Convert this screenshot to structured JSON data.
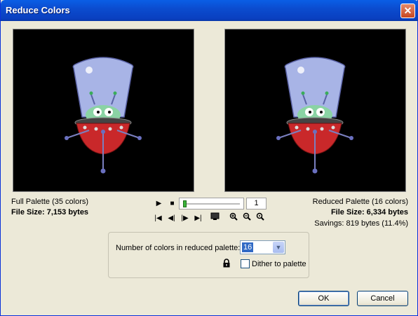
{
  "window": {
    "title": "Reduce Colors",
    "close_glyph": "✕"
  },
  "full": {
    "palette_label": "Full Palette  (35 colors)",
    "file_size": "File Size: 7,153 bytes"
  },
  "reduced": {
    "palette_label": "Reduced Palette  (16 colors)",
    "file_size": "File Size: 6,334 bytes",
    "savings": "Savings: 819 bytes (11.4%)"
  },
  "playback": {
    "play": "▶",
    "stop": "■",
    "first": "|◀",
    "prev": "◀|",
    "next": "|▶",
    "last": "▶|",
    "frame": "1",
    "icons": [
      "play-icon",
      "stop-icon",
      "first-frame-icon",
      "prev-frame-icon",
      "next-frame-icon",
      "last-frame-icon",
      "monitor-icon",
      "zoom-in-icon",
      "zoom-out-icon",
      "zoom-fit-icon"
    ]
  },
  "settings": {
    "colors_label": "Number of colors in reduced palette:",
    "colors_value": "16",
    "dither_label": "Dither to palette",
    "dither_checked": false
  },
  "buttons": {
    "ok": "OK",
    "cancel": "Cancel"
  }
}
